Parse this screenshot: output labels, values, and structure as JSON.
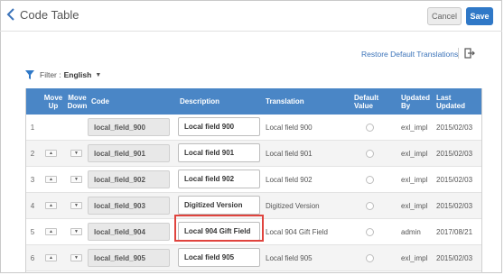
{
  "header": {
    "title": "Code Table",
    "cancel_label": "Cancel",
    "save_label": "Save"
  },
  "toolbar": {
    "restore_label": "Restore Default Translations"
  },
  "filter": {
    "label": "Filter :",
    "value": "English"
  },
  "table": {
    "columns": {
      "move_up": "Move Up",
      "move_down": "Move Down",
      "code": "Code",
      "description": "Description",
      "translation": "Translation",
      "default_value": "Default Value",
      "updated_by": "Updated By",
      "last_updated": "Last Updated"
    },
    "rows": [
      {
        "num": "1",
        "code": "local_field_900",
        "description": "Local field 900",
        "translation": "Local field 900",
        "updated_by": "exl_impl",
        "last_updated": "2015/02/03"
      },
      {
        "num": "2",
        "code": "local_field_901",
        "description": "Local field 901",
        "translation": "Local field 901",
        "updated_by": "exl_impl",
        "last_updated": "2015/02/03"
      },
      {
        "num": "3",
        "code": "local_field_902",
        "description": "Local field 902",
        "translation": "Local field 902",
        "updated_by": "exl_impl",
        "last_updated": "2015/02/03"
      },
      {
        "num": "4",
        "code": "local_field_903",
        "description": "Digitized Version",
        "translation": "Digitized Version",
        "updated_by": "exl_impl",
        "last_updated": "2015/02/03"
      },
      {
        "num": "5",
        "code": "local_field_904",
        "description": "Local 904 Gift Field",
        "translation": "Local 904 Gift Field",
        "updated_by": "admin",
        "last_updated": "2017/08/21"
      },
      {
        "num": "6",
        "code": "local_field_905",
        "description": "Local field 905",
        "translation": "Local field 905",
        "updated_by": "exl_impl",
        "last_updated": "2015/02/03"
      }
    ]
  },
  "colors": {
    "accent": "#2f78c7",
    "header_bg": "#4a86c6",
    "highlight": "#e0443e",
    "link": "#3b73b9"
  }
}
